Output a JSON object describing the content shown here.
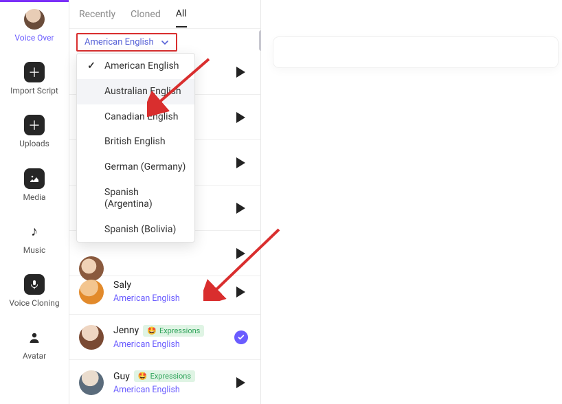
{
  "sidebar": {
    "items": [
      {
        "label": "Voice Over",
        "icon": "avatar"
      },
      {
        "label": "Import Script",
        "icon": "plus-box"
      },
      {
        "label": "Uploads",
        "icon": "plus-box"
      },
      {
        "label": "Media",
        "icon": "image-box"
      },
      {
        "label": "Music",
        "icon": "note"
      },
      {
        "label": "Voice Cloning",
        "icon": "mic-box"
      },
      {
        "label": "Avatar",
        "icon": "person"
      }
    ]
  },
  "tabs": {
    "items": [
      "Recently",
      "Cloned",
      "All"
    ],
    "active": "All"
  },
  "language_selector": {
    "selected": "American English",
    "options": [
      "American English",
      "Australian English",
      "Canadian English",
      "British English",
      "German (Germany)",
      "Spanish (Argentina)",
      "Spanish (Bolivia)"
    ],
    "hovered_index": 1
  },
  "voices": [
    {
      "name": "Saly",
      "lang": "American English",
      "badge": null,
      "action": "play"
    },
    {
      "name": "Jenny",
      "lang": "American English",
      "badge": "Expressions",
      "action": "selected"
    },
    {
      "name": "Guy",
      "lang": "American English",
      "badge": "Expressions",
      "action": "play"
    }
  ],
  "annotation": {
    "highlight_color": "#d92e2e",
    "arrows": 2
  }
}
